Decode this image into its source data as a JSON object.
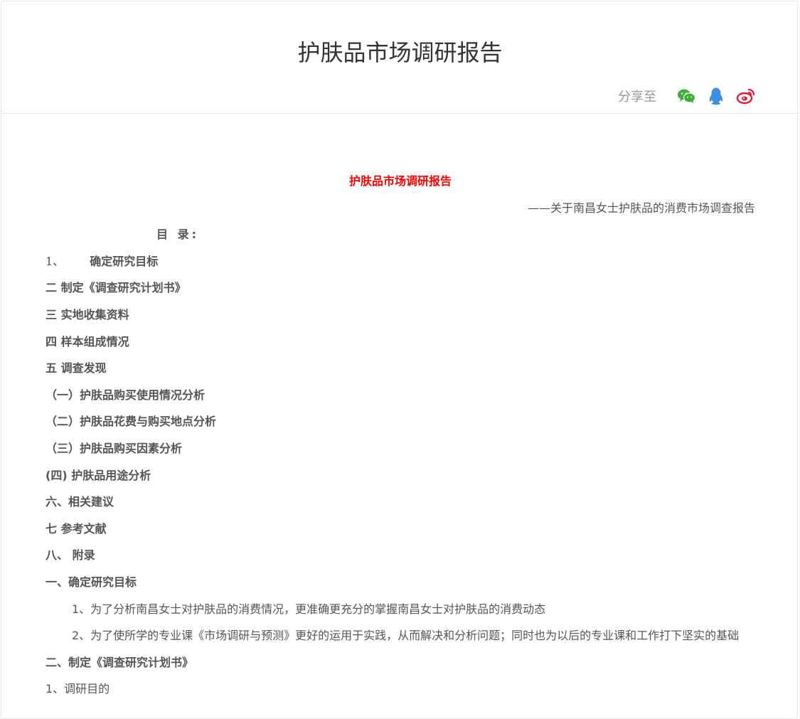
{
  "page": {
    "title": "护肤品市场调研报告",
    "share_label": "分享至",
    "share_icons": [
      "wechat-icon",
      "qq-icon",
      "weibo-icon"
    ]
  },
  "colors": {
    "doc_title": "#ff0000",
    "wechat": "#3cb034",
    "qq": "#3d8de0",
    "weibo": "#e6162d"
  },
  "article": {
    "title": "护肤品市场调研报告",
    "subtitle": "——关于南昌女士护肤品的消费市场调查报告",
    "toc_heading": "目 录:",
    "toc_first_num": "1、",
    "toc_first_text": "确定研究目标",
    "toc": [
      "二 制定《调查研究计划书》",
      "三 实地收集资料",
      "四 样本组成情况",
      "五 调查发现",
      "（一）护肤品购买使用情况分析",
      "（二）护肤品花费与购买地点分析",
      "（三）护肤品购买因素分析",
      "(四) 护肤品用途分析",
      "六、相关建议",
      "七 参考文献",
      "八、 附录"
    ],
    "section1_heading": "一、确定研究目标",
    "para1": "1、为了分析南昌女士对护肤品的消费情况，更准确更充分的掌握南昌女士对护肤品的消费动态",
    "para2": "2、为了使所学的专业课《市场调研与预测》更好的运用于实践，从而解决和分析问题；同时也为以后的专业课和工作打下坚实的基础",
    "section2_heading": "二、制定《调查研究计划书》",
    "cut_line": "1、调研目的"
  }
}
